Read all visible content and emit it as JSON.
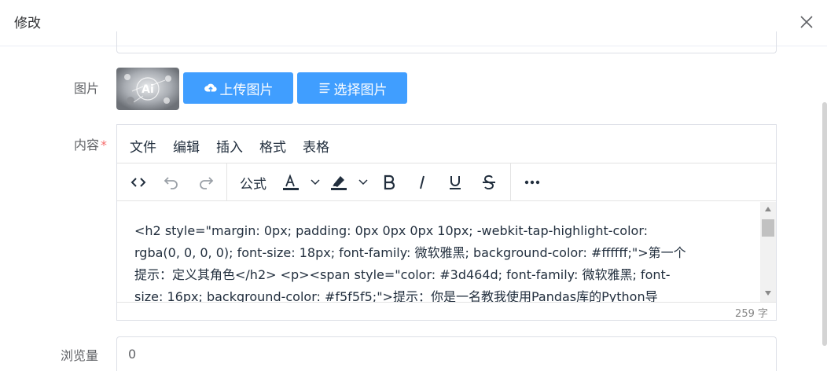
{
  "dialog": {
    "title": "修改"
  },
  "form": {
    "image_label": "图片",
    "upload_button": "上传图片",
    "select_button": "选择图片",
    "content_label": "内容",
    "required_mark": "*",
    "views_label": "浏览量",
    "views_value": "0"
  },
  "editor": {
    "menu": [
      "文件",
      "编辑",
      "插入",
      "格式",
      "表格"
    ],
    "toolbar": {
      "formula_label": "公式",
      "icons": [
        "source-code-icon",
        "undo-icon",
        "redo-icon",
        "text-color-icon",
        "highlight-color-icon",
        "bold-icon",
        "italic-icon",
        "underline-icon",
        "strikethrough-icon",
        "more-icon"
      ],
      "text_color": "#222f3e"
    },
    "content": "<h2 style=\"margin: 0px; padding: 0px 0px 0px 10px; -webkit-tap-highlight-color:\nrgba(0, 0, 0, 0); font-size: 18px; font-family: 微软雅黑; background-color: #ffffff;\">第一个\n提示：定义其角色</h2> <p><span style=\"color: #3d464d; font-family: 微软雅黑; font-\nsize: 16px; background-color: #f5f5f5;\">提示：你是一名教我使用Pandas库的Python导",
    "word_count": "259 字"
  },
  "colors": {
    "primary": "#409eff",
    "required": "#f56c6c"
  }
}
